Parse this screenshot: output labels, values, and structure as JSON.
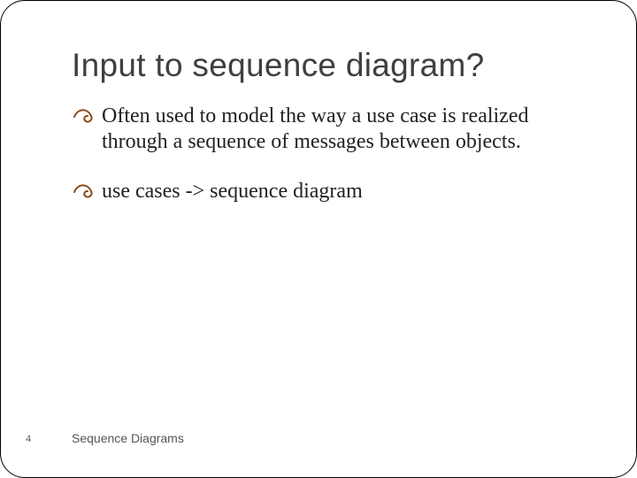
{
  "title": "Input to sequence diagram?",
  "bullets": [
    "Often used to model the way a use case is realized through a sequence of messages between objects.",
    "use cases -> sequence diagram"
  ],
  "footer": "Sequence Diagrams",
  "page_number": "4",
  "accent_color": "#8a4a1a"
}
